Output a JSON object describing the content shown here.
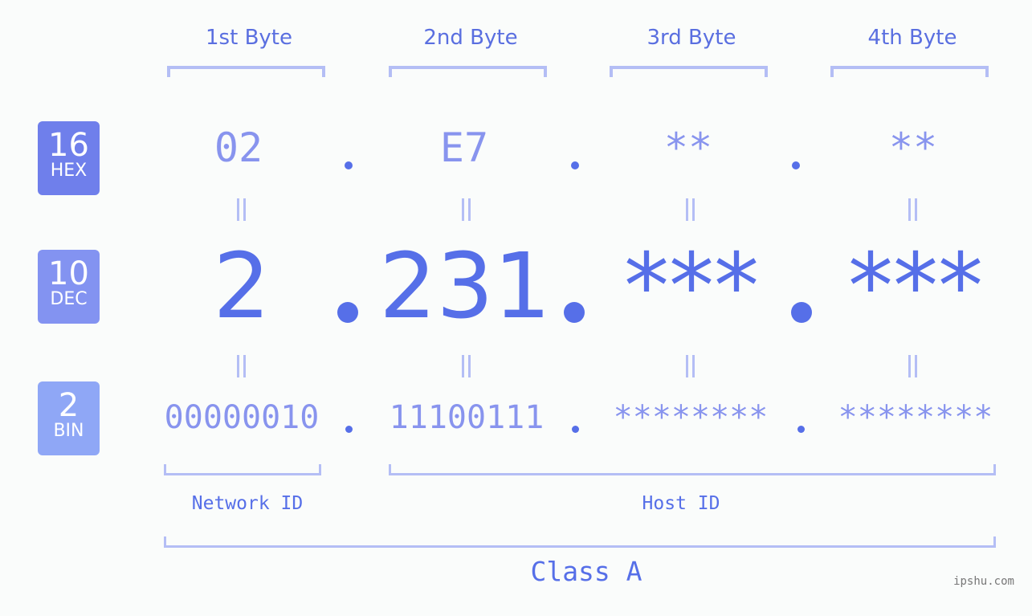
{
  "bases": [
    {
      "number": "16",
      "label": "HEX",
      "color": "#6f7feb"
    },
    {
      "number": "10",
      "label": "DEC",
      "color": "#8393f1"
    },
    {
      "number": "2",
      "label": "BIN",
      "color": "#8fa7f6"
    }
  ],
  "byte_headers": [
    "1st Byte",
    "2nd Byte",
    "3rd Byte",
    "4th Byte"
  ],
  "hex": [
    "02",
    "E7",
    "**",
    "**"
  ],
  "dec": [
    "2",
    "231",
    "***",
    "***"
  ],
  "bin": [
    "00000010",
    "11100111",
    "********",
    "********"
  ],
  "network_label": "Network ID",
  "host_label": "Host ID",
  "class_label": "Class A",
  "watermark": "ipshu.com",
  "colors": {
    "accent": "#566fe8",
    "light": "#8894ee",
    "bracket": "#b4bef5"
  }
}
